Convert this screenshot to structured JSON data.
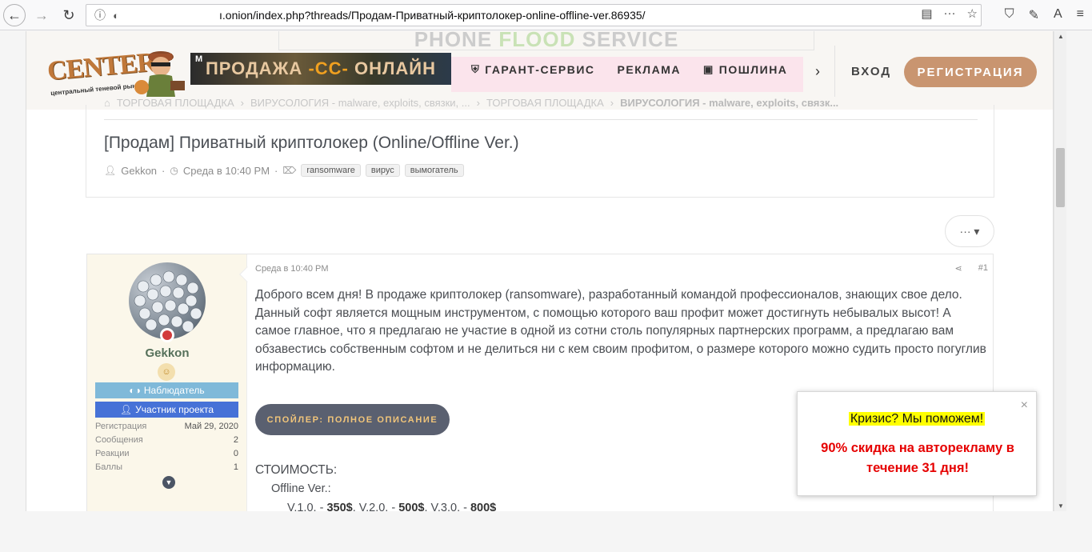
{
  "browser": {
    "url": "                                        ",
    "url_suffix": "ı.onion/index.php?threads/Продам-Приватный-криптолокер-online-offline-ver.86935/"
  },
  "header": {
    "top_banner_a": "PHONE ",
    "top_banner_b": "FLOOD",
    "top_banner_c": " SERVICE",
    "logo_text": "CENTER",
    "logo_sub": "центральный теневой рынок",
    "promo_pre": "ПРОДАЖА ",
    "promo_cc": "-CC-",
    "promo_post": " ОНЛАЙН",
    "promo_mini": "M",
    "nav": [
      {
        "label": "ГАРАНТ-СЕРВИС"
      },
      {
        "label": "РЕКЛАМА"
      },
      {
        "label": "ПОШЛИНА"
      }
    ],
    "login": "ВХОД",
    "register": "РЕГИСТРАЦИЯ"
  },
  "breadcrumb": [
    "ТОРГОВАЯ ПЛОЩАДКА",
    "ВИРУСОЛОГИЯ - malware, exploits, связки, ...",
    "ТОРГОВАЯ ПЛОЩАДКА",
    "ВИРУСОЛОГИЯ - malware, exploits, связк..."
  ],
  "thread": {
    "title": "[Продам] Приватный криптолокер (Online/Offline Ver.)",
    "author": "Gekkon",
    "date": "Среда в 10:40 PM",
    "tags": [
      "ransomware",
      "вирус",
      "вымогатель"
    ],
    "more": "··· ▾"
  },
  "post": {
    "username": "Gekkon",
    "roles": [
      "Наблюдатель",
      "Участник проекта"
    ],
    "stats": [
      {
        "label": "Регистрация",
        "value": "Май 29, 2020"
      },
      {
        "label": "Сообщения",
        "value": "2"
      },
      {
        "label": "Реакции",
        "value": "0"
      },
      {
        "label": "Баллы",
        "value": "1"
      }
    ],
    "date": "Среда в 10:40 PM",
    "number": "#1",
    "text": "Доброго всем дня! В продаже криптолокер (ransomware), разработанный командой профессионалов, знающих свое дело. Данный софт является мощным инструментом, с помощью которого ваш профит может достигнуть небывалых высот! А самое главное, что я предлагаю не участие в одной из сотни столь популярных партнерских программ, а предлагаю вам обзавестись собственным софтом и не делиться ни с кем своим профитом, о размере которого можно судить просто погуглив информацию.",
    "spoiler": "СПОЙЛЕР: ПОЛНОЕ ОПИСАНИЕ",
    "price_head": "СТОИМОСТЬ:",
    "price_sub": "Offline Ver.:",
    "prices": [
      {
        "label": "V.1.0. - ",
        "value": "350$"
      },
      {
        "label": ", V.2.0. - ",
        "value": "500$"
      },
      {
        "label": ", V.3.0. - ",
        "value": "800$"
      }
    ]
  },
  "popup": {
    "title": "Кризис? Мы поможем!",
    "offer": "90% скидка на авторекламу в течение 31 дня!",
    "close": "×"
  },
  "colors": {
    "accent": "#c99570",
    "role_observer": "#7fb9d9",
    "role_member": "#4672d7",
    "popup_offer": "#e60000"
  }
}
